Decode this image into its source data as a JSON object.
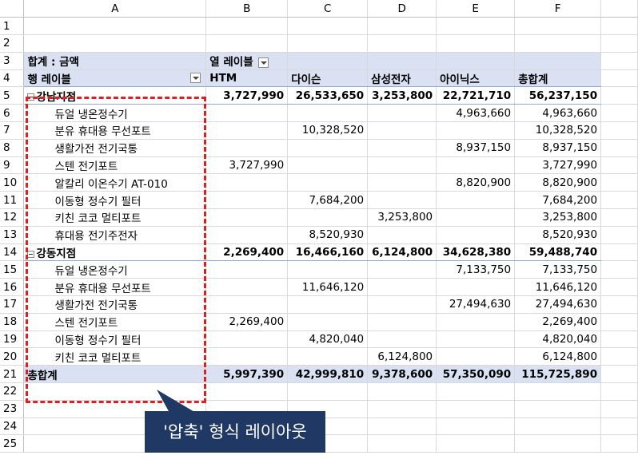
{
  "columns": [
    "A",
    "B",
    "C",
    "D",
    "E",
    "F"
  ],
  "rows": [
    "1",
    "2",
    "3",
    "4",
    "5",
    "6",
    "7",
    "8",
    "9",
    "10",
    "11",
    "12",
    "13",
    "14",
    "15",
    "16",
    "17",
    "18",
    "19",
    "20",
    "21",
    "22",
    "23",
    "24",
    "25"
  ],
  "pivot": {
    "sum_label": "합계 : 금액",
    "col_label": "열 레이블",
    "row_label": "행 레이블",
    "col_headers": [
      "HTM",
      "다이슨",
      "삼성전자",
      "아이닉스",
      "총합계"
    ],
    "groups": [
      {
        "name": "강남지점",
        "totals": [
          "3,727,990",
          "26,533,650",
          "3,253,800",
          "22,721,710",
          "56,237,150"
        ],
        "items": [
          {
            "name": "듀얼 냉온정수기",
            "values": [
              "",
              "",
              "",
              "4,963,660",
              "4,963,660"
            ]
          },
          {
            "name": "분유 휴대용 무선포트",
            "values": [
              "",
              "10,328,520",
              "",
              "",
              "10,328,520"
            ]
          },
          {
            "name": "생활가전 전기국통",
            "values": [
              "",
              "",
              "",
              "8,937,150",
              "8,937,150"
            ]
          },
          {
            "name": "스텐 전기포트",
            "values": [
              "3,727,990",
              "",
              "",
              "",
              "3,727,990"
            ]
          },
          {
            "name": "알칼리 이온수기 AT-010",
            "values": [
              "",
              "",
              "",
              "8,820,900",
              "8,820,900"
            ]
          },
          {
            "name": "이동형 정수기 필터",
            "values": [
              "",
              "7,684,200",
              "",
              "",
              "7,684,200"
            ]
          },
          {
            "name": "키친 코코 멀티포트",
            "values": [
              "",
              "",
              "3,253,800",
              "",
              "3,253,800"
            ]
          },
          {
            "name": "휴대용 전기주전자",
            "values": [
              "",
              "8,520,930",
              "",
              "",
              "8,520,930"
            ]
          }
        ]
      },
      {
        "name": "강동지점",
        "totals": [
          "2,269,400",
          "16,466,160",
          "6,124,800",
          "34,628,380",
          "59,488,740"
        ],
        "items": [
          {
            "name": "듀얼 냉온정수기",
            "values": [
              "",
              "",
              "",
              "7,133,750",
              "7,133,750"
            ]
          },
          {
            "name": "분유 휴대용 무선포트",
            "values": [
              "",
              "11,646,120",
              "",
              "",
              "11,646,120"
            ]
          },
          {
            "name": "생활가전 전기국통",
            "values": [
              "",
              "",
              "",
              "27,494,630",
              "27,494,630"
            ]
          },
          {
            "name": "스텐 전기포트",
            "values": [
              "2,269,400",
              "",
              "",
              "",
              "2,269,400"
            ]
          },
          {
            "name": "이동형 정수기 필터",
            "values": [
              "",
              "4,820,040",
              "",
              "",
              "4,820,040"
            ]
          },
          {
            "name": "키친 코코 멀티포트",
            "values": [
              "",
              "",
              "6,124,800",
              "",
              "6,124,800"
            ]
          }
        ]
      }
    ],
    "grand_total_label": "총합계",
    "grand_totals": [
      "5,997,390",
      "42,999,810",
      "9,378,600",
      "57,350,090",
      "115,725,890"
    ]
  },
  "callout": "'압축' 형식 레이아웃",
  "colors": {
    "band": "#d9e1f2",
    "dash": "#e02020",
    "callout_bg": "#1f3864"
  }
}
